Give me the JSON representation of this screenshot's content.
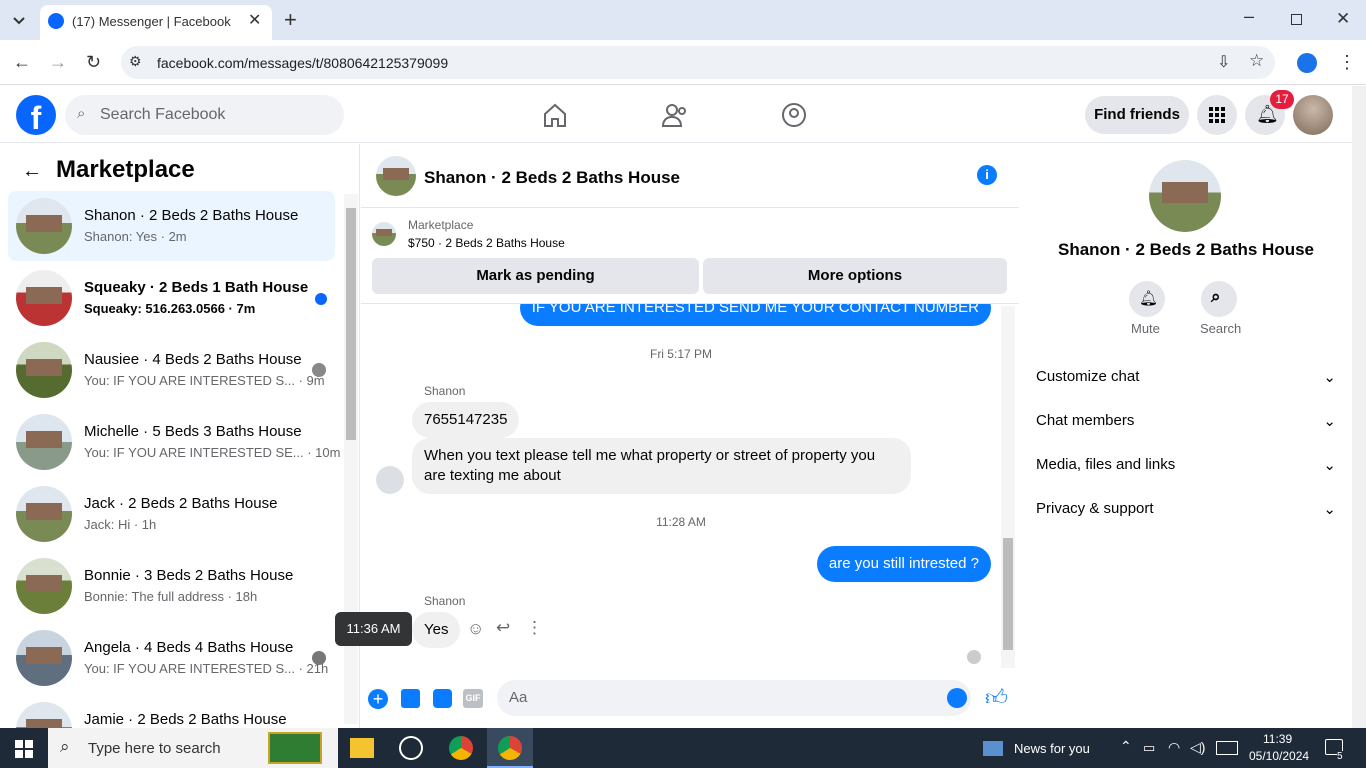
{
  "browser": {
    "tab_title": "(17) Messenger | Facebook",
    "url": "facebook.com/messages/t/8080642125379099"
  },
  "header": {
    "search_placeholder": "Search Facebook",
    "find_friends": "Find friends",
    "notif_count": "17"
  },
  "sidebar": {
    "title": "Marketplace",
    "conversations": [
      {
        "title": "Shanon · 2 Beds 2 Baths House",
        "preview": "Shanon: Yes · 2m",
        "selected": true
      },
      {
        "title": "Squeaky · 2 Beds 1 Bath House",
        "preview": "Squeaky: 516.263.0566 · 7m",
        "unread": true
      },
      {
        "title": "Nausiee · 4 Beds 2 Baths House",
        "preview": "You: IF YOU ARE INTERESTED S...  · 9m"
      },
      {
        "title": "Michelle · 5 Beds 3 Baths House",
        "preview": "You: IF YOU ARE INTERESTED SE...  · 10m"
      },
      {
        "title": "Jack · 2 Beds 2 Baths House",
        "preview": "Jack: Hi · 1h"
      },
      {
        "title": "Bonnie · 3 Beds 2 Baths House",
        "preview": "Bonnie: The full address · 18h"
      },
      {
        "title": "Angela · 4 Beds 4 Baths House",
        "preview": "You: IF YOU ARE INTERESTED S...  · 21h"
      },
      {
        "title": "Jamie · 2 Beds 2 Baths House",
        "preview": ""
      }
    ]
  },
  "chat": {
    "title": "Shanon · 2 Beds 2 Baths House",
    "listing_label": "Marketplace",
    "listing_price": "$750 · 2 Beds 2 Baths House",
    "mark_pending": "Mark as pending",
    "more_options": "More options",
    "top_msg": "IF YOU ARE INTERESTED SEND ME YOUR CONTACT NUMBER",
    "stamp1": "Fri 5:17 PM",
    "sender1": "Shanon",
    "msg1": "7655147235",
    "msg2": "When you text please tell me what property or street of property you are texting me about",
    "stamp2": "11:28 AM",
    "msg3": "are you still intrested ?",
    "sender2": "Shanon",
    "msg4": "Yes",
    "tooltip": "11:36 AM",
    "composer_placeholder": "Aa"
  },
  "details": {
    "name": "Shanon · 2 Beds 2 Baths House",
    "mute": "Mute",
    "search": "Search",
    "rows": [
      "Customize chat",
      "Chat members",
      "Media, files and links",
      "Privacy & support"
    ]
  },
  "taskbar": {
    "search_placeholder": "Type here to search",
    "news": "News for you",
    "time": "11:39",
    "date": "05/10/2024",
    "notif": "5"
  },
  "colors": {
    "fb_blue": "#0866ff",
    "messenger_blue": "#0a7cff",
    "notif_red": "#e41e3f"
  }
}
